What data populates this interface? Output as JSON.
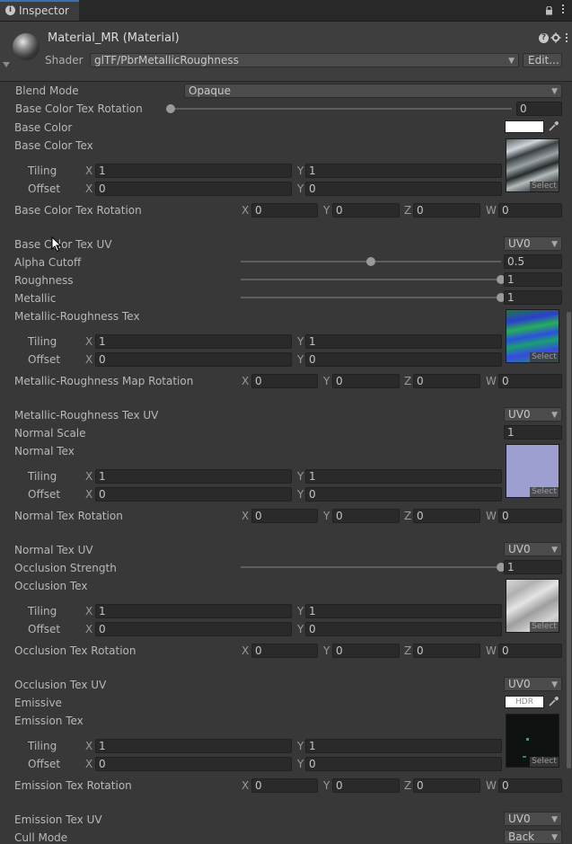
{
  "tab": {
    "title": "Inspector"
  },
  "header": {
    "material_name": "Material_MR (Material)",
    "shader_label": "Shader",
    "shader_value": "glTF/PbrMetallicRoughness",
    "edit_label": "Edit..."
  },
  "select_label": "Select",
  "rows": {
    "blend_mode": {
      "label": "Blend Mode",
      "value": "Opaque"
    },
    "base_color_tex_rotation_slider": {
      "label": "Base Color Tex Rotation",
      "value": "0",
      "fraction": 0
    },
    "base_color": {
      "label": "Base Color",
      "color": "#ffffff"
    },
    "base_color_tex": {
      "label": "Base Color Tex",
      "tiling_label": "Tiling",
      "offset_label": "Offset",
      "tiling_x": "1",
      "tiling_y": "1",
      "offset_x": "0",
      "offset_y": "0"
    },
    "base_color_tex_rotation": {
      "label": "Base Color Tex Rotation",
      "x": "0",
      "y": "0",
      "z": "0",
      "w": "0"
    },
    "base_color_tex_uv": {
      "label": "Base Color Tex UV",
      "value": "UV0"
    },
    "alpha_cutoff": {
      "label": "Alpha Cutoff",
      "value": "0.5",
      "fraction": 0.5
    },
    "roughness": {
      "label": "Roughness",
      "value": "1",
      "fraction": 1
    },
    "metallic": {
      "label": "Metallic",
      "value": "1",
      "fraction": 1
    },
    "mr_tex": {
      "label": "Metallic-Roughness Tex",
      "tiling_label": "Tiling",
      "offset_label": "Offset",
      "tiling_x": "1",
      "tiling_y": "1",
      "offset_x": "0",
      "offset_y": "0"
    },
    "mr_map_rotation": {
      "label": "Metallic-Roughness Map Rotation",
      "x": "0",
      "y": "0",
      "z": "0",
      "w": "0"
    },
    "mr_tex_uv": {
      "label": "Metallic-Roughness Tex UV",
      "value": "UV0"
    },
    "normal_scale": {
      "label": "Normal Scale",
      "value": "1"
    },
    "normal_tex": {
      "label": "Normal Tex",
      "tiling_label": "Tiling",
      "offset_label": "Offset",
      "tiling_x": "1",
      "tiling_y": "1",
      "offset_x": "0",
      "offset_y": "0"
    },
    "normal_tex_rotation": {
      "label": "Normal Tex Rotation",
      "x": "0",
      "y": "0",
      "z": "0",
      "w": "0"
    },
    "normal_tex_uv": {
      "label": "Normal Tex UV",
      "value": "UV0"
    },
    "occlusion_strength": {
      "label": "Occlusion Strength",
      "value": "1",
      "fraction": 1
    },
    "occlusion_tex": {
      "label": "Occlusion Tex",
      "tiling_label": "Tiling",
      "offset_label": "Offset",
      "tiling_x": "1",
      "tiling_y": "1",
      "offset_x": "0",
      "offset_y": "0"
    },
    "occlusion_tex_rotation": {
      "label": "Occlusion Tex Rotation",
      "x": "0",
      "y": "0",
      "z": "0",
      "w": "0"
    },
    "occlusion_tex_uv": {
      "label": "Occlusion Tex UV",
      "value": "UV0"
    },
    "emissive": {
      "label": "Emissive",
      "hdr": "HDR"
    },
    "emission_tex": {
      "label": "Emission Tex",
      "tiling_label": "Tiling",
      "offset_label": "Offset",
      "tiling_x": "1",
      "tiling_y": "1",
      "offset_x": "0",
      "offset_y": "0"
    },
    "emission_tex_rotation": {
      "label": "Emission Tex Rotation",
      "x": "0",
      "y": "0",
      "z": "0",
      "w": "0"
    },
    "emission_tex_uv": {
      "label": "Emission Tex UV",
      "value": "UV0"
    },
    "cull_mode": {
      "label": "Cull Mode",
      "value": "Back"
    }
  },
  "axis": {
    "x": "X",
    "y": "Y",
    "z": "Z",
    "w": "W"
  },
  "icons": [
    "info-icon",
    "lock-icon",
    "menu-icon",
    "material-sphere-icon",
    "help-icon",
    "settings-icon",
    "kebab-icon",
    "foldout-icon",
    "dropdown-arrow-icon",
    "eyedropper-icon",
    "mouse-cursor-icon"
  ]
}
